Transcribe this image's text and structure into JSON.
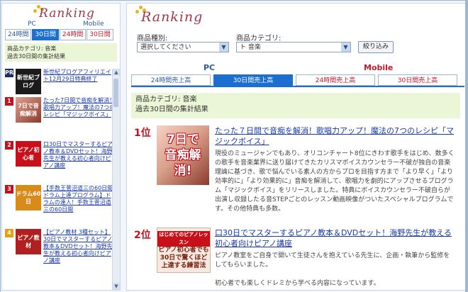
{
  "colors": {
    "accent": "#1a6fd1",
    "brand": "#9a3a4a",
    "pc": "#2a5aa8",
    "mobile": "#c21a2a",
    "rank": "#c8101a",
    "info_bg": "#eaf6d6"
  },
  "sidebar": {
    "logo": "Ranking",
    "pc_label": "PC",
    "mobile_label": "Mobile",
    "tabs": [
      {
        "label": "24時間",
        "type": "pc"
      },
      {
        "label": "30日間",
        "type": "pc"
      },
      {
        "label": "24時間",
        "type": "mb"
      },
      {
        "label": "30日間",
        "type": "mb"
      }
    ],
    "info_line1": "商品カテゴリ: 音楽",
    "info_line2": "過去30日間の集計結果",
    "items": [
      {
        "badge": "PR",
        "thumb_text": "新世紀ブログ",
        "text": "新世紀ブログアフィリエイト12月29日特典終了"
      },
      {
        "badge": "1",
        "thumb_text": "7日で音痴解消",
        "text": "たった7日間で音痴を解消！歌唱力アップ！魔法の7つのレシピ「マジックボイス」"
      },
      {
        "badge": "2",
        "thumb_text": "ピアノ初心者",
        "text": "口30日でマスターするピアノ教本＆DVDセット！海野先生が教える初心者向けピアノ講座"
      },
      {
        "badge": "3",
        "thumb_text": "ドラム60日",
        "text": "【手数王菅沼道三の60日間ドラム上達プログラム】ドラムの達人！手数王菅沼道三の60日間"
      },
      {
        "badge": "4",
        "thumb_text": "ピアノ教材",
        "text": "【ピアノ教材 3種セット】30日でマスターするピアノ教本＆DVDセット！海野先生が教える初心者向けピアノ講座"
      }
    ]
  },
  "main": {
    "logo": "Ranking",
    "product_type_label": "商品種別:",
    "product_type_value": "選択してください",
    "category_label": "商品カテゴリ:",
    "category_value": "ト 音楽",
    "narrow_button": "絞り込み",
    "pc_label": "PC",
    "mobile_label": "Mobile",
    "tabs": [
      {
        "label": "24時間売上高",
        "type": "pc"
      },
      {
        "label": "30日間売上高",
        "type": "pc"
      },
      {
        "label": "24時間売上高",
        "type": "mb"
      },
      {
        "label": "30日間売上高",
        "type": "mb"
      }
    ],
    "info_line1": "商品カテゴリ: 音楽",
    "info_line2": "過去30日間の集計結果",
    "rank1": {
      "rank": "1位",
      "thumb_line1": "7日で",
      "thumb_line2": "音痴解消!",
      "title": "たった７日間で音痴を解消！歌唱力アップ！魔法の7つのレシピ「マジックボイス」",
      "desc": "現役のミュージャンでもあり、オリコンチャート8位にきわす歌手をはじめ、数多くの歌手を音楽業界に送り届けてきたカリスマボイスカウンセラー不破が独自の音楽理論に基づき、歌で悩んでいる素人の方からプロを目指す方まで「より早く」「より効率的に」「より効果的に」音痴を解消して、歌唱力を劇的にアップさせるプログラム「マジックボイス」をリリースしました。特典にボイスカウンセラー不破自らが出演し収録したる音STEPごとのレッスン動画映像がついたスペシャルプログラムです。その他特典も多数。"
    },
    "rank2": {
      "rank": "2位",
      "thumb_band": "はじめてのピアノレッスン",
      "thumb_line1": "ピアノ初心者でも",
      "thumb_line2": "30日で驚くほど",
      "thumb_line3": "上達する練習法",
      "title": "口30日でマスターするピアノ教本＆DVDセット！海野先生が教える初心者向けピアノ講座",
      "desc": "ピアノ教室をご自身で開いて生徒さんを抱えている先生に、企画・執筆から監修をしてもらいました。\n\n初心者でも楽しくドレミから学べる内容になっています。"
    }
  }
}
